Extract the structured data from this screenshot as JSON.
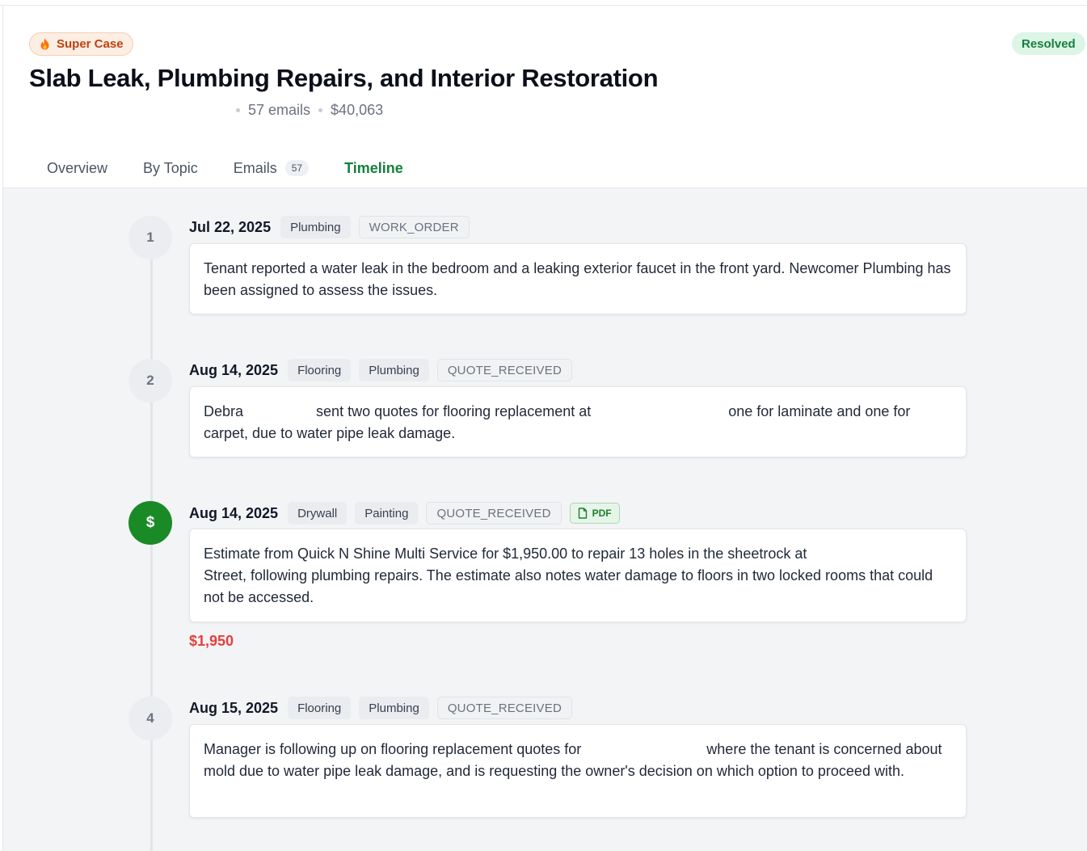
{
  "header": {
    "super_badge": "Super Case",
    "status_badge": "Resolved",
    "title": "Slab Leak, Plumbing Repairs, and Interior Restoration",
    "meta": {
      "emails": "57 emails",
      "amount": "$40,063"
    }
  },
  "tabs": [
    {
      "label": "Overview"
    },
    {
      "label": "By Topic"
    },
    {
      "label": "Emails",
      "count": "57"
    },
    {
      "label": "Timeline"
    }
  ],
  "timeline": [
    {
      "marker": "1",
      "date": "Jul 22, 2025",
      "tags": [
        "Plumbing"
      ],
      "type": "WORK_ORDER",
      "text": "Tenant reported a water leak in the bedroom and a leaking exterior faucet in the front yard. Newcomer Plumbing has been assigned to assess the issues."
    },
    {
      "marker": "2",
      "date": "Aug 14, 2025",
      "tags": [
        "Flooring",
        "Plumbing"
      ],
      "type": "QUOTE_RECEIVED",
      "text": "Debra                  sent two quotes for flooring replacement at                                  one for laminate and one for carpet, due to water pipe leak damage."
    },
    {
      "marker": "$",
      "date": "Aug 14, 2025",
      "tags": [
        "Drywall",
        "Painting"
      ],
      "type": "QUOTE_RECEIVED",
      "attachment": "PDF",
      "text": "Estimate from Quick N Shine Multi Service for $1,950.00 to repair 13 holes in the sheetrock at                                  Street, following plumbing repairs. The estimate also notes water damage to floors in two locked rooms that could not be accessed.",
      "amount": "$1,950"
    },
    {
      "marker": "4",
      "date": "Aug 15, 2025",
      "tags": [
        "Flooring",
        "Plumbing"
      ],
      "type": "QUOTE_RECEIVED",
      "text": "Manager is following up on flooring replacement quotes for                               where the tenant is concerned about mold due to water pipe leak damage, and is requesting the owner's decision on which option to proceed with."
    }
  ],
  "colors": {
    "accent": "#15803d",
    "money_marker": "#1a8a26",
    "amount": "#e53e3e",
    "super_badge": "#c2410c"
  }
}
